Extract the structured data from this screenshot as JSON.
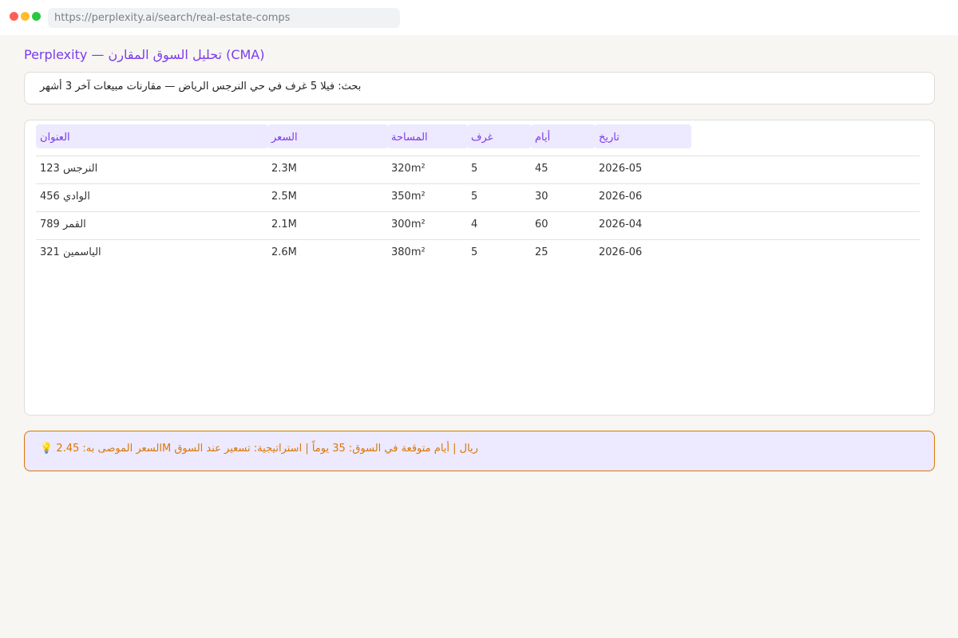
{
  "browser": {
    "url": "https://perplexity.ai/search/real-estate-comps"
  },
  "page": {
    "title": "Perplexity — تحليل السوق المقارن (CMA)"
  },
  "query": {
    "text": "بحث: فيلا 5 غرف في حي النرجس الرياض — مقارنات مبيعات آخر 3 أشهر"
  },
  "table": {
    "headers": {
      "address": "العنوان",
      "price": "السعر",
      "area": "المساحة",
      "rooms": "غرف",
      "days": "أيام",
      "date": "تاريخ"
    },
    "rows": [
      {
        "address": "النرجس 123",
        "price": "2.3M",
        "area": "320m²",
        "rooms": "5",
        "days": "45",
        "date": "2026-05"
      },
      {
        "address": "الوادي 456",
        "price": "2.5M",
        "area": "350m²",
        "rooms": "5",
        "days": "30",
        "date": "2026-06"
      },
      {
        "address": "القمر 789",
        "price": "2.1M",
        "area": "300m²",
        "rooms": "4",
        "days": "60",
        "date": "2026-04"
      },
      {
        "address": "الياسمين 321",
        "price": "2.6M",
        "area": "380m²",
        "rooms": "5",
        "days": "25",
        "date": "2026-06"
      }
    ]
  },
  "recommendation": {
    "text": "💡 السعر الموصى به: 2.45M ريال | أيام متوقعة في السوق: 35 يوماً | استراتيجية: تسعير عند السوق"
  },
  "colors": {
    "accent": "#7c3aed",
    "header_bg": "#ede9fe",
    "warning": "#d97706"
  }
}
